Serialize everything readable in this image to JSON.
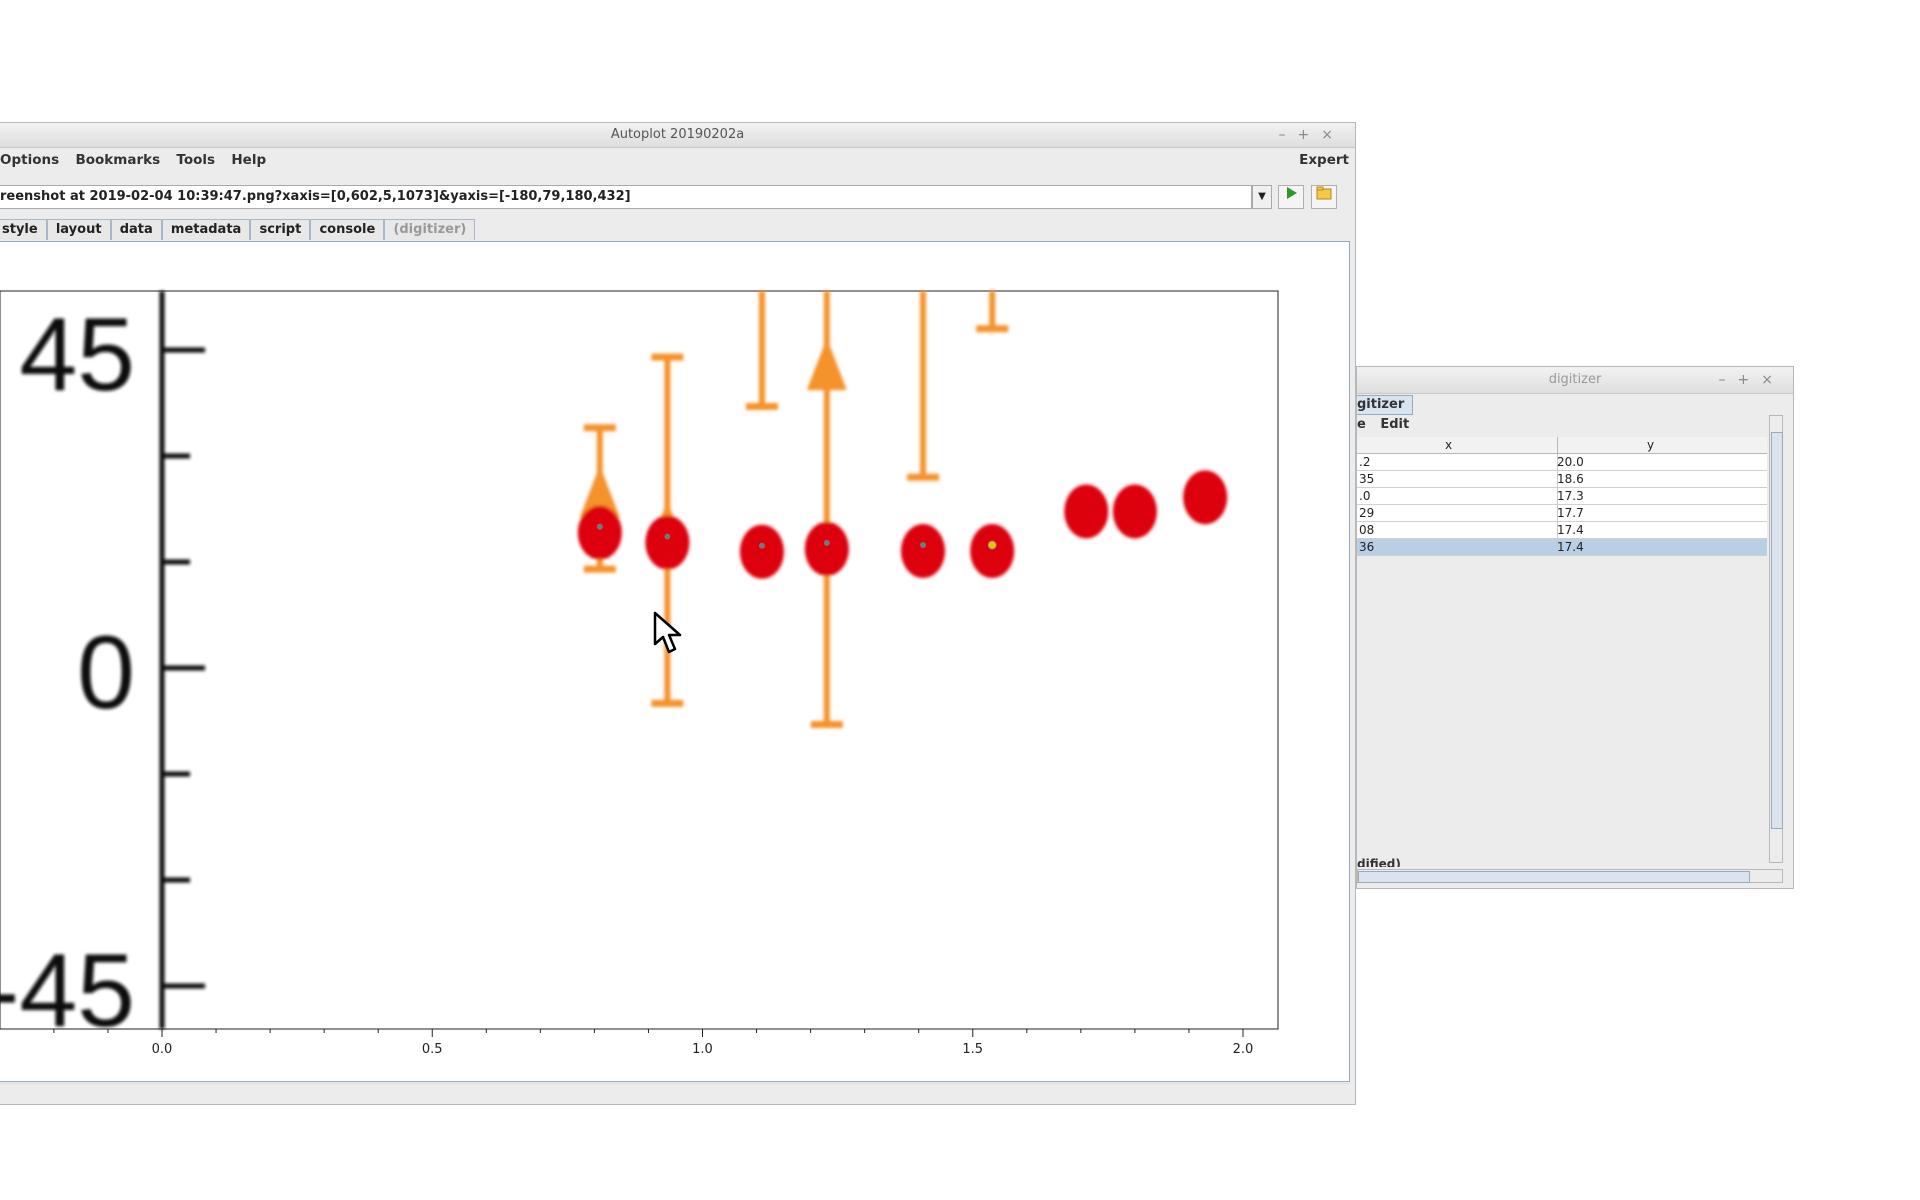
{
  "main_window": {
    "title": "Autoplot 20190202a",
    "menu": [
      "Options",
      "Bookmarks",
      "Tools",
      "Help"
    ],
    "menu_right": "Expert",
    "url": "reenshot at 2019-02-04 10:39:47.png?xaxis=[0,602,5,1073]&yaxis=[-180,79,180,432]",
    "tabs": [
      "style",
      "layout",
      "data",
      "metadata",
      "script",
      "console",
      "(digitizer)"
    ]
  },
  "plot": {
    "y_image_labels": [
      "45",
      "0",
      "-45"
    ],
    "x_ticks": [
      "0.0",
      "0.5",
      "1.0",
      "1.5",
      "2.0"
    ],
    "red_points": [
      {
        "x": 0.81,
        "y": 20.0
      },
      {
        "x": 0.935,
        "y": 18.6
      },
      {
        "x": 1.11,
        "y": 17.3
      },
      {
        "x": 1.23,
        "y": 17.7
      },
      {
        "x": 1.408,
        "y": 17.4
      },
      {
        "x": 1.536,
        "y": 17.4
      },
      {
        "x": 1.71,
        "y": 23.0
      },
      {
        "x": 1.8,
        "y": 23.0
      },
      {
        "x": 1.93,
        "y": 25.0
      }
    ],
    "digitized_highlight_index": 5,
    "colors": {
      "red": "#dd0011",
      "orange": "#f5922a",
      "highlight": "#f0c000"
    }
  },
  "digitizer": {
    "title": "digitizer",
    "tab_label": "gitizer",
    "menu": [
      "e",
      "Edit"
    ],
    "columns": [
      "x",
      "y"
    ],
    "rows": [
      {
        "x": ".2",
        "y": "20.0"
      },
      {
        "x": "35",
        "y": "18.6"
      },
      {
        "x": ".0",
        "y": "17.3"
      },
      {
        "x": "29",
        "y": "17.7"
      },
      {
        "x": "08",
        "y": "17.4"
      },
      {
        "x": "36",
        "y": "17.4"
      }
    ],
    "selected_row": 5,
    "status": "dified)"
  }
}
